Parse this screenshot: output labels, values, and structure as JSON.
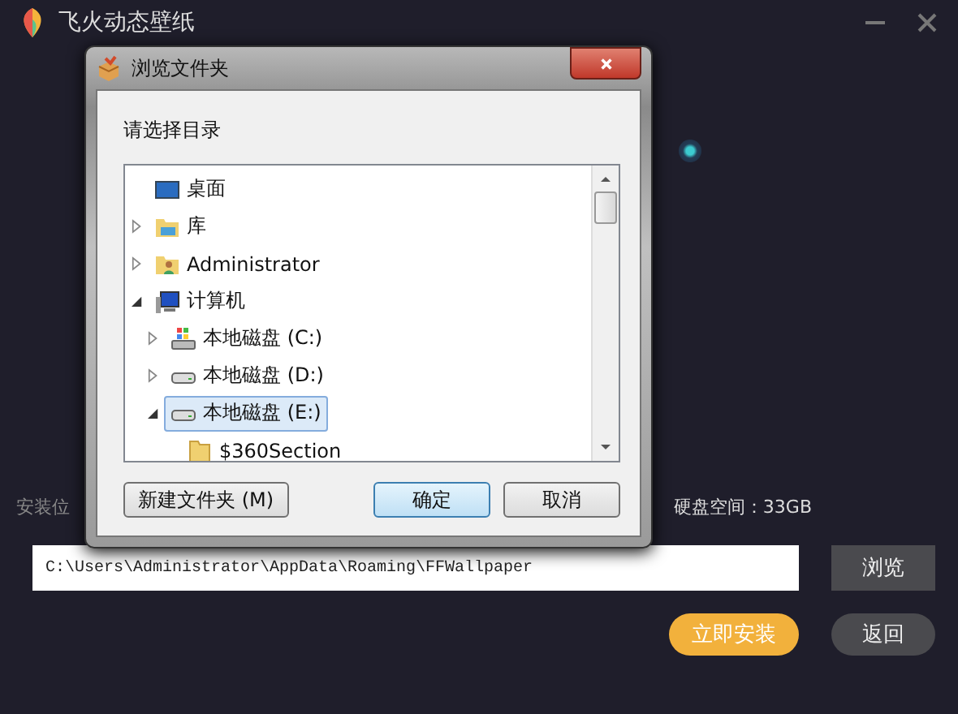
{
  "app": {
    "title": "飞火动态壁纸"
  },
  "install": {
    "location_label": "安装位",
    "disk_space": "硬盘空间：33GB",
    "path": "C:\\Users\\Administrator\\AppData\\Roaming\\FFWallpaper",
    "browse_button": "浏览",
    "install_button": "立即安装",
    "back_button": "返回"
  },
  "dialog": {
    "title": "浏览文件夹",
    "prompt": "请选择目录",
    "tree": [
      {
        "label": "桌面",
        "kind": "desktop",
        "selected": false
      },
      {
        "label": "库",
        "kind": "library",
        "expanded": false,
        "selected": false
      },
      {
        "label": "Administrator",
        "kind": "user",
        "expanded": false,
        "selected": false
      },
      {
        "label": "计算机",
        "kind": "computer",
        "expanded": true,
        "selected": false,
        "children": [
          {
            "label": "本地磁盘 (C:)",
            "kind": "system-drive",
            "expanded": false,
            "selected": false
          },
          {
            "label": "本地磁盘 (D:)",
            "kind": "drive",
            "expanded": false,
            "selected": false
          },
          {
            "label": "本地磁盘 (E:)",
            "kind": "drive",
            "expanded": true,
            "selected": true,
            "children": [
              {
                "label": "$360Section",
                "kind": "folder",
                "selected": false
              }
            ]
          }
        ]
      }
    ],
    "buttons": [
      {
        "label": "新建文件夹 (M)",
        "kind": "plain"
      },
      {
        "label": "确定",
        "kind": "default"
      },
      {
        "label": "取消",
        "kind": "plain"
      }
    ]
  }
}
